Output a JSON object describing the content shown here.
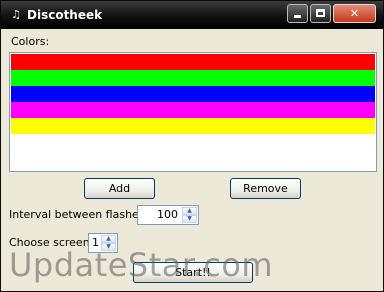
{
  "window": {
    "title": "Discotheek",
    "controls": {
      "minimize": "",
      "maximize": "",
      "close": "✕"
    }
  },
  "colors": {
    "label": "Colors:",
    "items": [
      {
        "name": "red",
        "hex": "#ff0000"
      },
      {
        "name": "green",
        "hex": "#00ff00"
      },
      {
        "name": "blue",
        "hex": "#0000ff"
      },
      {
        "name": "magenta",
        "hex": "#ff00ff"
      },
      {
        "name": "yellow",
        "hex": "#ffff00"
      }
    ]
  },
  "buttons": {
    "add": "Add",
    "remove": "Remove",
    "start": "Start!!"
  },
  "interval": {
    "label": "Interval between flashes:",
    "value": "100"
  },
  "screen": {
    "label": "Choose screen:",
    "value": "1"
  },
  "watermark": "UpdateStar.com"
}
